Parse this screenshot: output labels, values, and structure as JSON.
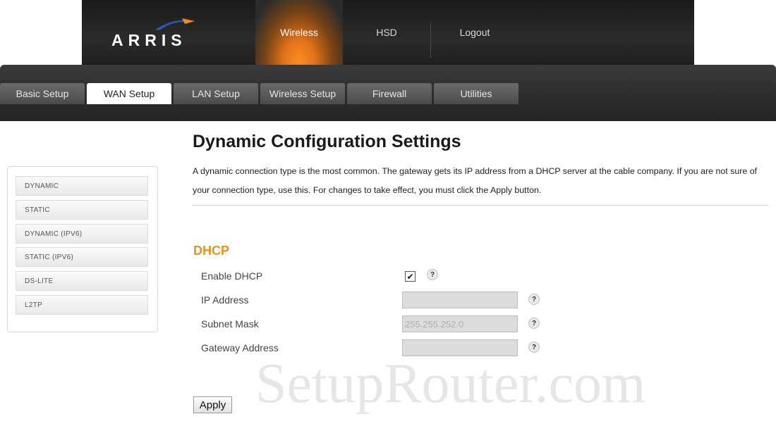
{
  "header": {
    "logo_text": "ARRIS",
    "nav": [
      "Wireless",
      "HSD",
      "Logout"
    ],
    "active_color": "#ff8a1e"
  },
  "tabs": [
    {
      "label": "Basic Setup",
      "active": false
    },
    {
      "label": "WAN Setup",
      "active": true
    },
    {
      "label": "LAN Setup",
      "active": false
    },
    {
      "label": "Wireless Setup",
      "active": false
    },
    {
      "label": "Firewall",
      "active": false
    },
    {
      "label": "Utilities",
      "active": false
    }
  ],
  "sidebar": {
    "items": [
      "DYNAMIC",
      "STATIC",
      "DYNAMIC (IPV6)",
      "STATIC (IPV6)",
      "DS-LITE",
      "L2TP"
    ]
  },
  "main": {
    "title": "Dynamic Configuration Settings",
    "description": "A dynamic connection type is the most common. The gateway gets its IP address from a DHCP server at the cable company. If you are not sure of your connection type, use this. For changes to take effect, you must click the Apply button.",
    "section_title": "DHCP",
    "section_color": "#e8931e",
    "fields": {
      "enable_dhcp_label": "Enable DHCP",
      "enable_dhcp_checked": true,
      "ip_address_label": "IP Address",
      "ip_address_value": "",
      "subnet_mask_label": "Subnet Mask",
      "subnet_mask_value": "255.255.252.0",
      "gateway_label": "Gateway Address",
      "gateway_value": ""
    },
    "help_glyph": "?",
    "apply_label": "Apply"
  },
  "watermark": "SetupRouter.com"
}
